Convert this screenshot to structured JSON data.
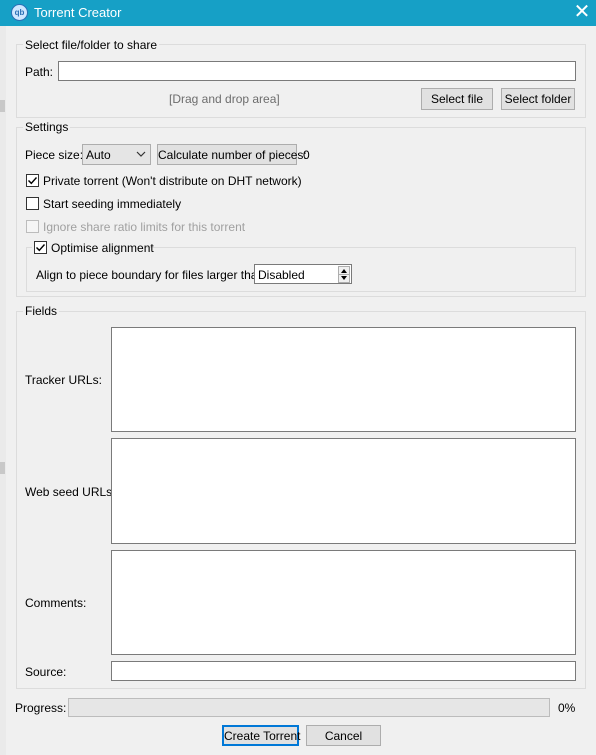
{
  "window": {
    "title": "Torrent Creator",
    "icon": "qbittorrent-logo-icon",
    "icon_text": "qb",
    "close_glyph": "✕"
  },
  "source_group": {
    "title": "Select file/folder to share",
    "path_label": "Path:",
    "path_value": "",
    "drag_drop_text": "[Drag and drop area]",
    "select_file_label": "Select file",
    "select_folder_label": "Select folder"
  },
  "settings": {
    "title": "Settings",
    "piece_size_label": "Piece size:",
    "piece_size_value": "Auto",
    "calculate_label": "Calculate number of pieces:",
    "pieces_count": "0",
    "private_torrent": {
      "label": "Private torrent (Won't distribute on DHT network)",
      "checked": true
    },
    "start_seeding": {
      "label": "Start seeding immediately",
      "checked": false
    },
    "ignore_ratio": {
      "label": "Ignore share ratio limits for this torrent",
      "checked": false,
      "enabled": false
    },
    "optimise_alignment": {
      "label": "Optimise alignment",
      "checked": true
    },
    "align_label": "Align to piece boundary for files larger than:",
    "align_value": "Disabled"
  },
  "fields": {
    "title": "Fields",
    "tracker_urls_label": "Tracker URLs:",
    "tracker_urls_value": "",
    "web_seed_urls_label": "Web seed URLs:",
    "web_seed_urls_value": "",
    "comments_label": "Comments:",
    "comments_value": "",
    "source_label": "Source:",
    "source_value": ""
  },
  "progress": {
    "label": "Progress:",
    "value": 0,
    "text": "0%"
  },
  "buttons": {
    "create_label": "Create Torrent",
    "cancel_label": "Cancel"
  },
  "colors": {
    "titlebar": "#16a0c6",
    "background": "#f0f0f0",
    "focus": "#0078d7"
  }
}
